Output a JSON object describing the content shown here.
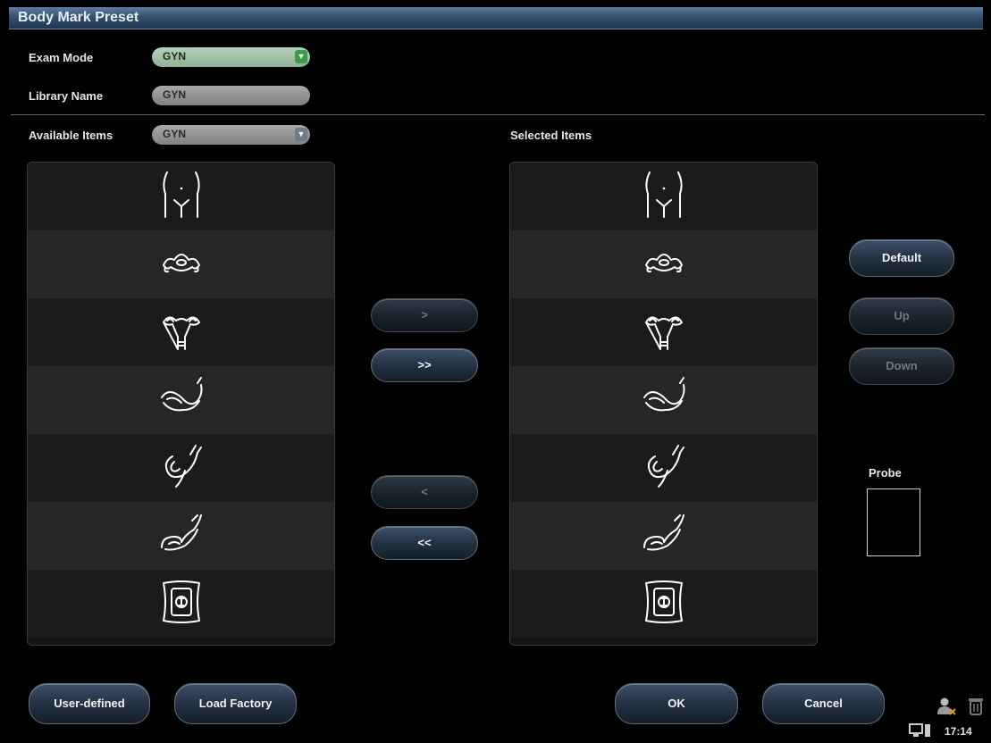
{
  "window": {
    "title": "Body Mark Preset"
  },
  "form": {
    "exam_mode_label": "Exam Mode",
    "exam_mode_value": "GYN",
    "library_name_label": "Library Name",
    "library_name_value": "GYN",
    "available_items_label": "Available Items",
    "available_items_value": "GYN",
    "selected_items_label": "Selected Items"
  },
  "available_items": [
    {
      "icon": "pelvis-icon"
    },
    {
      "icon": "ovary-icon"
    },
    {
      "icon": "uterus-adnexa-icon"
    },
    {
      "icon": "uterus-sagittal-icon"
    },
    {
      "icon": "uterus-anteverted-icon"
    },
    {
      "icon": "uterus-retroverted-icon"
    },
    {
      "icon": "uterus-frame-icon"
    }
  ],
  "selected_items": [
    {
      "icon": "pelvis-icon"
    },
    {
      "icon": "ovary-icon"
    },
    {
      "icon": "uterus-adnexa-icon"
    },
    {
      "icon": "uterus-sagittal-icon"
    },
    {
      "icon": "uterus-anteverted-icon"
    },
    {
      "icon": "uterus-retroverted-icon"
    },
    {
      "icon": "uterus-frame-icon"
    }
  ],
  "transfer": {
    "add_one": ">",
    "add_all": ">>",
    "remove_one": "<",
    "remove_all": "<<"
  },
  "side": {
    "default": "Default",
    "up": "Up",
    "down": "Down",
    "probe_label": "Probe"
  },
  "footer": {
    "user_defined": "User-defined",
    "load_factory": "Load Factory",
    "ok": "OK",
    "cancel": "Cancel"
  },
  "status": {
    "time": "17:14"
  },
  "colors": {
    "title_bar": "#34516f",
    "combo_active": "#8fb295",
    "combo_arrow": "#3f9a4d"
  }
}
